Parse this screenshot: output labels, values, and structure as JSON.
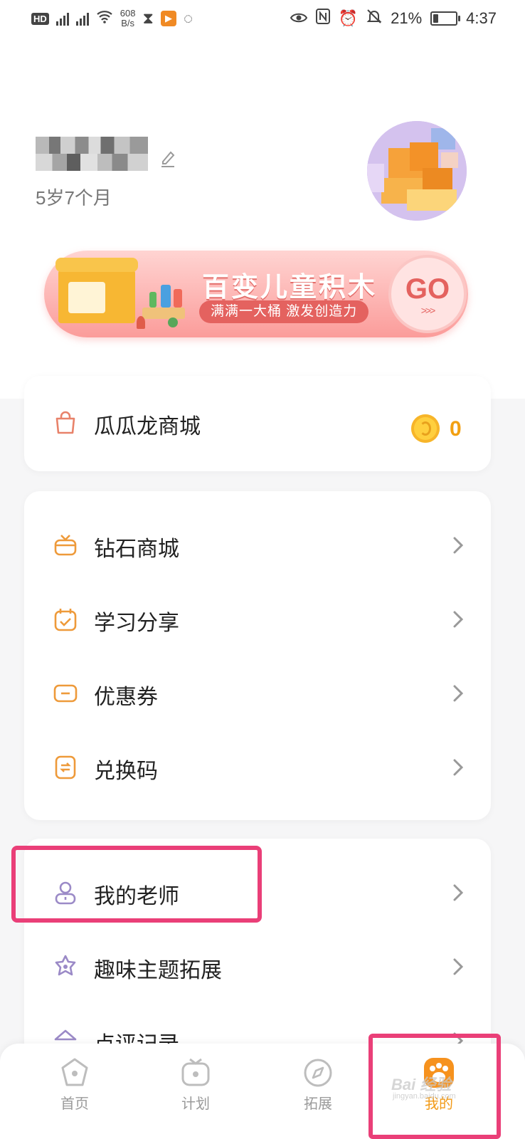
{
  "status_bar": {
    "hd_badge": "HD",
    "speed": "608",
    "speed_unit": "B/s",
    "battery": "21%",
    "time": "4:37"
  },
  "profile": {
    "age": "5岁7个月"
  },
  "banner": {
    "title": "百变儿童积木",
    "subtitle": "满满一大桶 激发创造力",
    "go_label": "GO",
    "go_arrows": ">>>"
  },
  "shop": {
    "label": "瓜瓜龙商城",
    "coins": "0"
  },
  "menu1": [
    {
      "label": "钻石商城",
      "icon": "diamond-shop-icon"
    },
    {
      "label": "学习分享",
      "icon": "calendar-check-icon"
    },
    {
      "label": "优惠券",
      "icon": "coupon-icon"
    },
    {
      "label": "兑换码",
      "icon": "redeem-code-icon"
    }
  ],
  "menu2": [
    {
      "label": "我的老师",
      "icon": "teacher-icon"
    },
    {
      "label": "趣味主题拓展",
      "icon": "flower-icon"
    },
    {
      "label": "点评记录",
      "icon": "review-icon"
    }
  ],
  "tabs": [
    {
      "label": "首页",
      "active": false
    },
    {
      "label": "计划",
      "active": false
    },
    {
      "label": "拓展",
      "active": false
    },
    {
      "label": "我的",
      "active": true
    }
  ],
  "colors": {
    "accent": "#f29a17",
    "highlight": "#ea3f78",
    "banner": "#fb9c9a",
    "teacher_icon": "#9b8ac7"
  },
  "watermark": {
    "text": "Bai 经验",
    "sub": "jingyan.baidu.com"
  }
}
